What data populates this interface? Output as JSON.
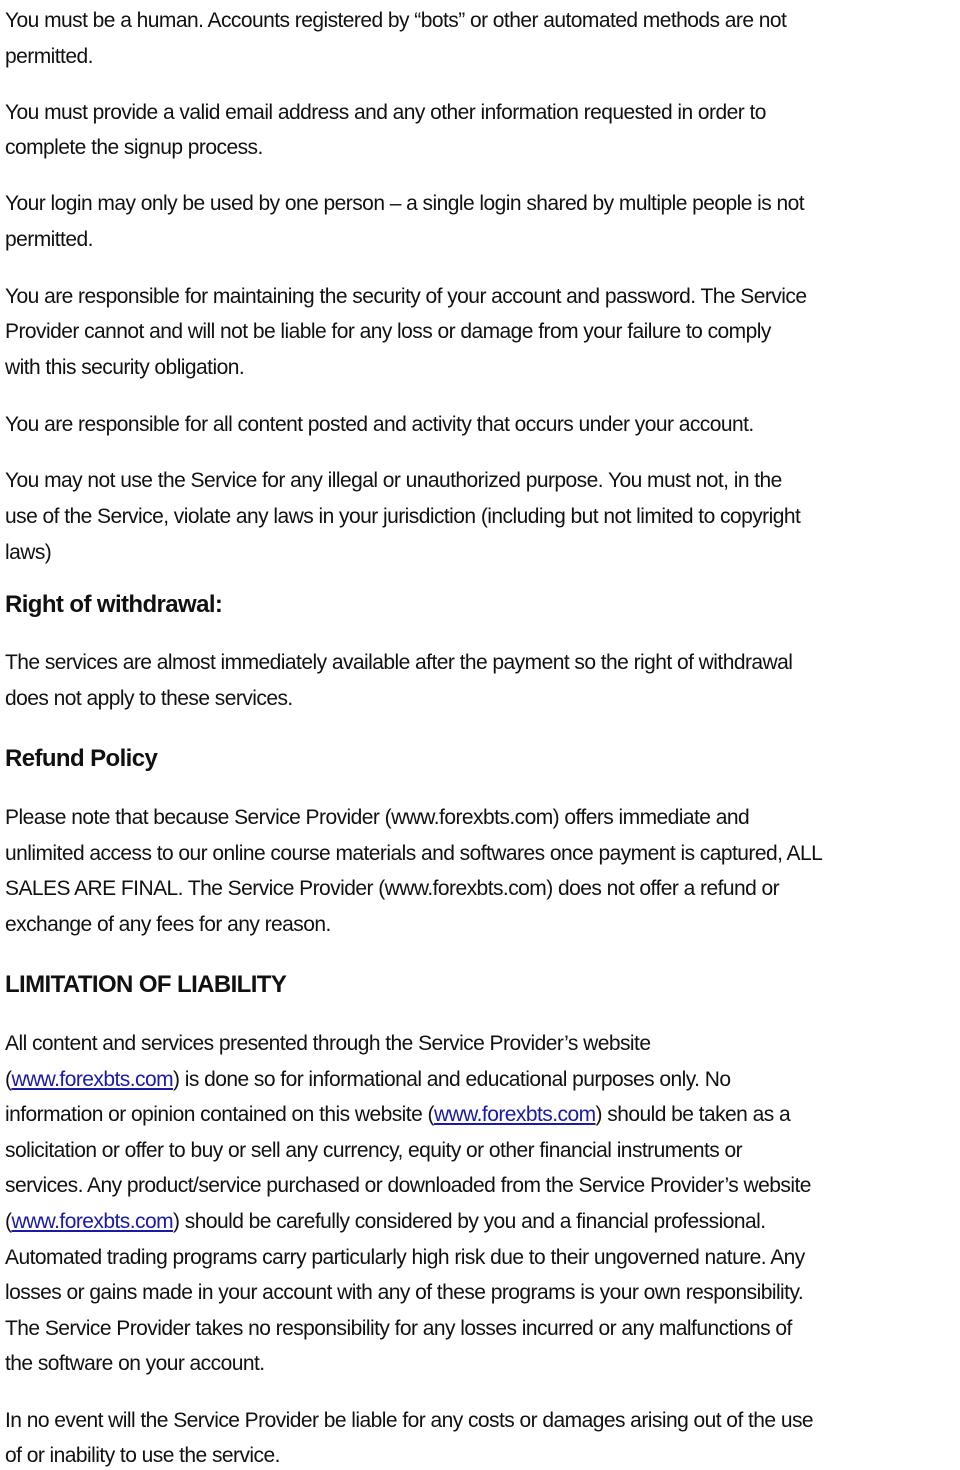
{
  "document": {
    "paragraphs_top": [
      {
        "lines": [
          "You must be a human. Accounts registered by “bots” or other automated methods are not",
          "permitted."
        ]
      },
      {
        "lines": [
          "You must provide a valid email address and any other information requested in order to",
          "complete the signup process."
        ]
      },
      {
        "lines": [
          "Your login may only be used by one person – a single login shared by multiple people is not",
          "permitted."
        ]
      },
      {
        "lines": [
          "You are responsible for maintaining the security of your account and password. The Service",
          "Provider cannot and will not be liable for any loss or damage from your failure to comply",
          "with this security obligation."
        ]
      },
      {
        "lines": [
          "You are responsible for all content posted and activity that occurs under your account."
        ]
      },
      {
        "lines": [
          "You may not use the Service for any illegal or unauthorized purpose. You must not, in the",
          "use of the Service, violate any laws in your jurisdiction (including but not limited to copyright",
          "laws)"
        ]
      }
    ],
    "withdrawal": {
      "heading": "Right of withdrawal:",
      "lines": [
        "The services are almost immediately available after the payment so the right of withdrawal",
        "does not apply to these services."
      ]
    },
    "refund": {
      "heading": "Refund Policy",
      "lines": [
        "Please note that because Service Provider (www.forexbts.com) offers immediate and",
        "unlimited access to our online course materials and softwares once payment is captured, ALL",
        "SALES ARE FINAL. The Service Provider (www.forexbts.com) does not offer a refund or",
        "exchange of any fees for any reason."
      ]
    },
    "liability": {
      "heading": "LIMITATION OF LIABILITY",
      "link_text": "www.forexbts.com",
      "link_color": "#1a1aa6",
      "l1": "All content and services presented through the Service Provider’s website",
      "l2_pre": "(",
      "l2_post": ") is done so for informational and educational purposes only. No",
      "l3_pre": "information or opinion contained on this website (",
      "l3_post": ") should be taken as a",
      "l4": "solicitation or offer to buy or sell any currency, equity or other financial instruments or",
      "l5": "services. Any product/service purchased or downloaded from the Service Provider’s website",
      "l6_pre": "(",
      "l6_post": ") should be carefully considered by you and a financial professional.",
      "l7": "Automated trading programs carry particularly high risk due to their ungoverned nature. Any",
      "l8": "losses or gains made in your account with any of these programs is your own responsibility.",
      "l9": "The Service Provider takes no responsibility for any losses incurred or any malfunctions of",
      "l10": "the software on your account.",
      "final_lines": [
        "In no event will the Service Provider be liable for any costs or damages arising out of the use",
        "of or inability to use the service."
      ]
    }
  }
}
